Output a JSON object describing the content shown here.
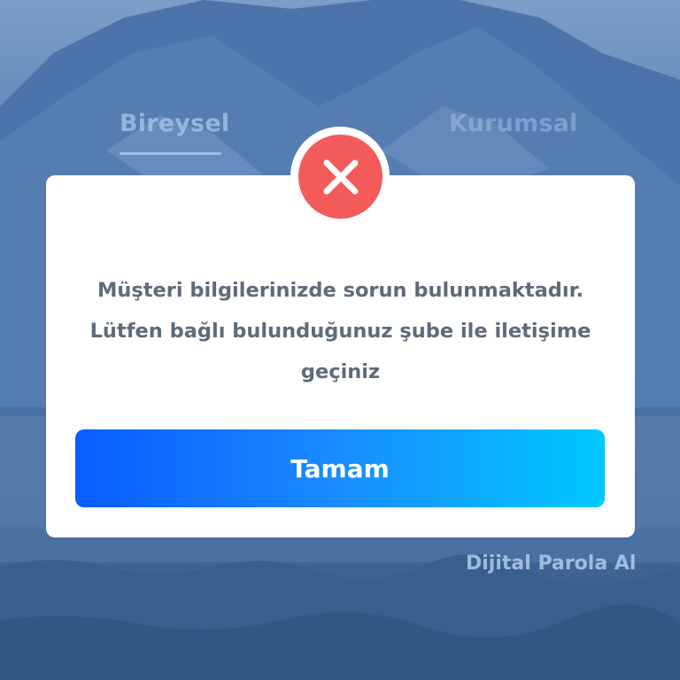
{
  "tabs": [
    {
      "label": "Bireysel",
      "active": true
    },
    {
      "label": "Kurumsal",
      "active": false
    }
  ],
  "links": {
    "digital_password": "Dijital Parola Al"
  },
  "dialog": {
    "icon": "close-icon",
    "message_lines": [
      "Müşteri bilgilerinizde sorun bulunmaktadır.",
      "Lütfen bağlı bulunduğunuz şube ile iletişime",
      "geçiniz"
    ],
    "ok_label": "Tamam"
  },
  "colors": {
    "error": "#f35a5a",
    "button_gradient_start": "#0a5cff",
    "button_gradient_end": "#00c8ff",
    "message_text": "#5f6b7a"
  }
}
